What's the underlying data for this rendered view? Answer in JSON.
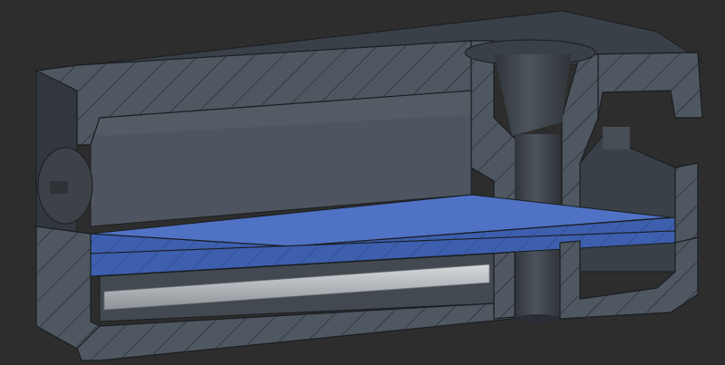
{
  "view": {
    "type": "cad-section-view",
    "cut_faces_hatched": true,
    "colors": {
      "background": "#2d2d2d",
      "housing_cut_face": "#4f5761",
      "housing_body": "#3e444b",
      "housing_dark": "#30353b",
      "interior_wall": "#5a6068",
      "blue_plate": "#3d5fae",
      "blue_plate_light": "#4f72c4",
      "light_rod": "#bcc0c4",
      "hatch": "#252a30",
      "edge": "#1a1d21"
    }
  }
}
